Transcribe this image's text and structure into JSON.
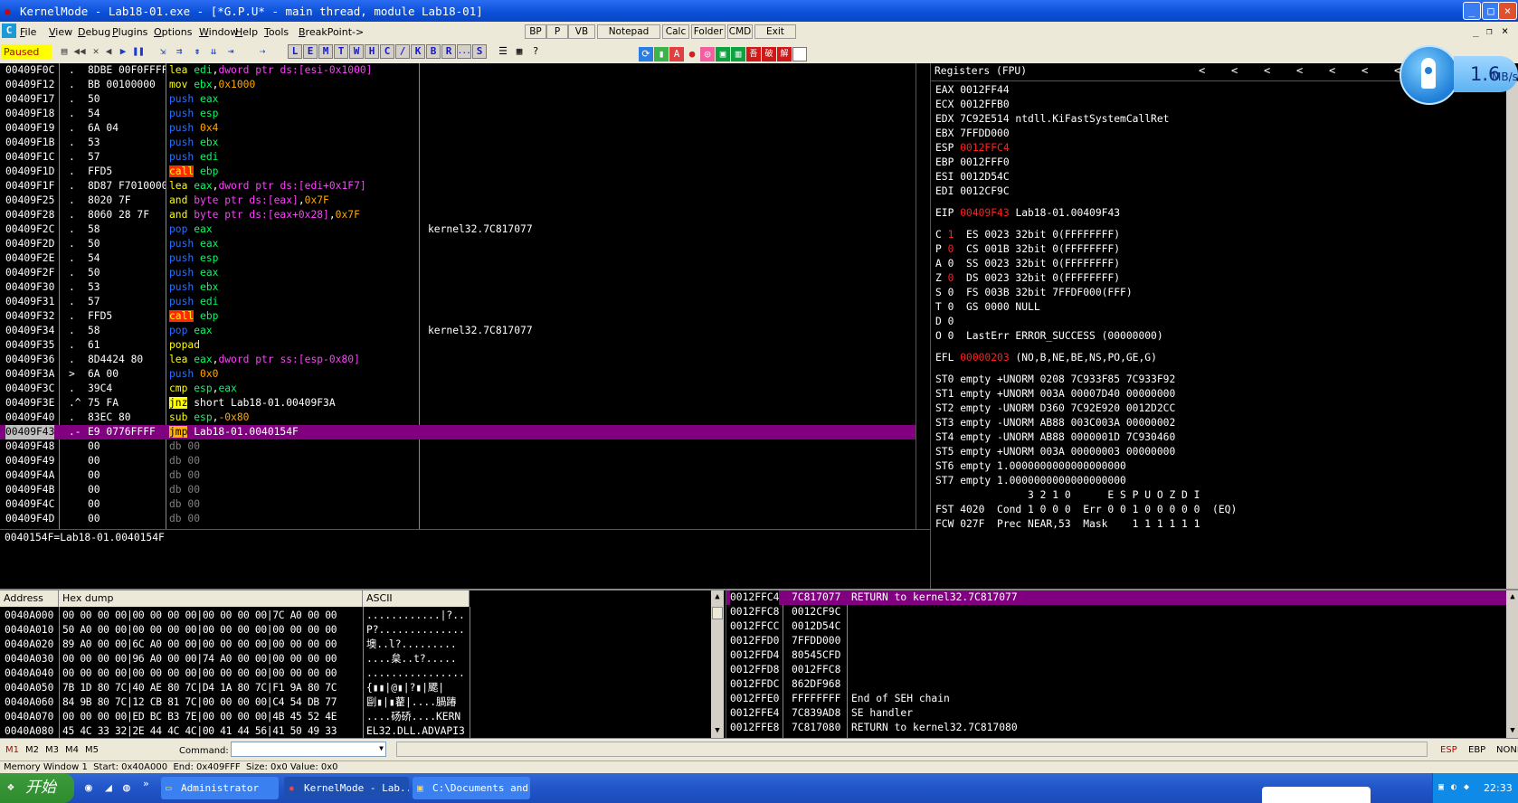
{
  "window": {
    "title": "KernelMode - Lab18-01.exe - [*G.P.U* - main thread, module Lab18-01]",
    "minimize": "_",
    "maximize": "□",
    "close": "×",
    "inner_min": "_",
    "inner_restore": "❐",
    "inner_close": "×"
  },
  "menu": {
    "mdi_icon": "C",
    "items": [
      "File",
      "View",
      "Debug",
      "Plugins",
      "Options",
      "Window",
      "Help",
      "Tools",
      "BreakPoint->"
    ],
    "buttons": [
      "BP",
      "P",
      "VB",
      "Notepad",
      "Calc",
      "Folder",
      "CMD",
      "Exit"
    ]
  },
  "toolbar": {
    "status": "Paused",
    "letters": [
      "L",
      "E",
      "M",
      "T",
      "W",
      "H",
      "C",
      "/",
      "K",
      "B",
      "R",
      "...",
      "S"
    ]
  },
  "disasm": {
    "rows": [
      {
        "addr": "00409F0C",
        "mk": ".",
        "hex": "8DBE 00F0FFFF",
        "mn": "lea",
        "cls": "mn-lea",
        "ops": [
          [
            "edi",
            "reg"
          ],
          [
            ",",
            ""
          ],
          [
            "dword ptr ds:[esi-0x1000]",
            "ptr"
          ]
        ]
      },
      {
        "addr": "00409F12",
        "mk": ".",
        "hex": "BB 00100000",
        "mn": "mov",
        "cls": "mn-mov",
        "ops": [
          [
            "ebx",
            "reg"
          ],
          [
            ",",
            ""
          ],
          [
            "0x1000",
            "imm"
          ]
        ]
      },
      {
        "addr": "00409F17",
        "mk": ".",
        "hex": "50",
        "mn": "push",
        "cls": "mn-push",
        "ops": [
          [
            "eax",
            "reg"
          ]
        ]
      },
      {
        "addr": "00409F18",
        "mk": ".",
        "hex": "54",
        "mn": "push",
        "cls": "mn-push",
        "ops": [
          [
            "esp",
            "reg"
          ]
        ]
      },
      {
        "addr": "00409F19",
        "mk": ".",
        "hex": "6A 04",
        "mn": "push",
        "cls": "mn-push",
        "ops": [
          [
            "0x4",
            "imm"
          ]
        ]
      },
      {
        "addr": "00409F1B",
        "mk": ".",
        "hex": "53",
        "mn": "push",
        "cls": "mn-push",
        "ops": [
          [
            "ebx",
            "reg"
          ]
        ]
      },
      {
        "addr": "00409F1C",
        "mk": ".",
        "hex": "57",
        "mn": "push",
        "cls": "mn-push",
        "ops": [
          [
            "edi",
            "reg"
          ]
        ]
      },
      {
        "addr": "00409F1D",
        "mk": ".",
        "hex": "FFD5",
        "mn": "call",
        "cls": "mn-call",
        "ops": [
          [
            "ebp",
            "reg"
          ]
        ]
      },
      {
        "addr": "00409F1F",
        "mk": ".",
        "hex": "8D87 F7010000",
        "mn": "lea",
        "cls": "mn-lea",
        "ops": [
          [
            "eax",
            "reg"
          ],
          [
            ",",
            ""
          ],
          [
            "dword ptr ds:[edi+0x1F7]",
            "ptr"
          ]
        ]
      },
      {
        "addr": "00409F25",
        "mk": ".",
        "hex": "8020 7F",
        "mn": "and",
        "cls": "mn-and",
        "ops": [
          [
            "byte ptr ds:[eax]",
            "ptr"
          ],
          [
            ",",
            ""
          ],
          [
            "0x7F",
            "imm"
          ]
        ]
      },
      {
        "addr": "00409F28",
        "mk": ".",
        "hex": "8060 28 7F",
        "mn": "and",
        "cls": "mn-and",
        "ops": [
          [
            "byte ptr ds:[eax+0x28]",
            "ptr"
          ],
          [
            ",",
            ""
          ],
          [
            "0x7F",
            "imm"
          ]
        ]
      },
      {
        "addr": "00409F2C",
        "mk": ".",
        "hex": "58",
        "mn": "pop",
        "cls": "mn-pop",
        "ops": [
          [
            "eax",
            "reg"
          ]
        ],
        "cmt": "kernel32.7C817077"
      },
      {
        "addr": "00409F2D",
        "mk": ".",
        "hex": "50",
        "mn": "push",
        "cls": "mn-push",
        "ops": [
          [
            "eax",
            "reg"
          ]
        ]
      },
      {
        "addr": "00409F2E",
        "mk": ".",
        "hex": "54",
        "mn": "push",
        "cls": "mn-push",
        "ops": [
          [
            "esp",
            "reg"
          ]
        ]
      },
      {
        "addr": "00409F2F",
        "mk": ".",
        "hex": "50",
        "mn": "push",
        "cls": "mn-push",
        "ops": [
          [
            "eax",
            "reg"
          ]
        ]
      },
      {
        "addr": "00409F30",
        "mk": ".",
        "hex": "53",
        "mn": "push",
        "cls": "mn-push",
        "ops": [
          [
            "ebx",
            "reg"
          ]
        ]
      },
      {
        "addr": "00409F31",
        "mk": ".",
        "hex": "57",
        "mn": "push",
        "cls": "mn-push",
        "ops": [
          [
            "edi",
            "reg"
          ]
        ]
      },
      {
        "addr": "00409F32",
        "mk": ".",
        "hex": "FFD5",
        "mn": "call",
        "cls": "mn-call",
        "ops": [
          [
            "ebp",
            "reg"
          ]
        ]
      },
      {
        "addr": "00409F34",
        "mk": ".",
        "hex": "58",
        "mn": "pop",
        "cls": "mn-pop",
        "ops": [
          [
            "eax",
            "reg"
          ]
        ],
        "cmt": "kernel32.7C817077"
      },
      {
        "addr": "00409F35",
        "mk": ".",
        "hex": "61",
        "mn": "popad",
        "cls": "mn-popad",
        "ops": []
      },
      {
        "addr": "00409F36",
        "mk": ".",
        "hex": "8D4424 80",
        "mn": "lea",
        "cls": "mn-lea",
        "ops": [
          [
            "eax",
            "reg"
          ],
          [
            ",",
            ""
          ],
          [
            "dword ptr ss:[esp-0x80]",
            "ptr"
          ]
        ]
      },
      {
        "addr": "00409F3A",
        "mk": ">",
        "hex": "6A 00",
        "mn": "push",
        "cls": "mn-push",
        "ops": [
          [
            "0x0",
            "imm"
          ]
        ]
      },
      {
        "addr": "00409F3C",
        "mk": ".",
        "hex": "39C4",
        "mn": "cmp",
        "cls": "mn-cmp",
        "ops": [
          [
            "esp",
            "reg"
          ],
          [
            ",",
            ""
          ],
          [
            "eax",
            "reg"
          ]
        ]
      },
      {
        "addr": "00409F3E",
        "mk": ".^",
        "hex": "75 FA",
        "mn": "jnz",
        "cls": "mn-jnz",
        "ops": [
          [
            "short Lab18-01.00409F3A",
            "w"
          ]
        ]
      },
      {
        "addr": "00409F40",
        "mk": ".",
        "hex": "83EC 80",
        "mn": "sub",
        "cls": "mn-sub",
        "ops": [
          [
            "esp",
            "reg"
          ],
          [
            ",",
            ""
          ],
          [
            "-0x80",
            "imm"
          ]
        ]
      },
      {
        "addr": "00409F43",
        "mk": ".-",
        "hex": "E9 0776FFFF",
        "mn": "jmp",
        "cls": "mn-jmp",
        "ops": [
          [
            "Lab18-01.0040154F",
            "w"
          ]
        ],
        "sel": true
      },
      {
        "addr": "00409F48",
        "mk": "",
        "hex": "00",
        "mn": "db",
        "cls": "mn-db",
        "ops": [
          [
            "00",
            "db"
          ]
        ]
      },
      {
        "addr": "00409F49",
        "mk": "",
        "hex": "00",
        "mn": "db",
        "cls": "mn-db",
        "ops": [
          [
            "00",
            "db"
          ]
        ]
      },
      {
        "addr": "00409F4A",
        "mk": "",
        "hex": "00",
        "mn": "db",
        "cls": "mn-db",
        "ops": [
          [
            "00",
            "db"
          ]
        ]
      },
      {
        "addr": "00409F4B",
        "mk": "",
        "hex": "00",
        "mn": "db",
        "cls": "mn-db",
        "ops": [
          [
            "00",
            "db"
          ]
        ]
      },
      {
        "addr": "00409F4C",
        "mk": "",
        "hex": "00",
        "mn": "db",
        "cls": "mn-db",
        "ops": [
          [
            "00",
            "db"
          ]
        ]
      },
      {
        "addr": "00409F4D",
        "mk": "",
        "hex": "00",
        "mn": "db",
        "cls": "mn-db",
        "ops": [
          [
            "00",
            "db"
          ]
        ]
      }
    ],
    "info": "0040154F=Lab18-01.0040154F"
  },
  "registers": {
    "header": "Registers (FPU)",
    "arrows": [
      "<",
      "<",
      "<",
      "<",
      "<",
      "<",
      "<"
    ],
    "lines": [
      {
        "t": "EAX 0012FF44"
      },
      {
        "t": "ECX 0012FFB0"
      },
      {
        "t": "EDX 7C92E514 ntdll.KiFastSystemCallRet"
      },
      {
        "t": "EBX 7FFDD000"
      },
      {
        "p": "ESP ",
        "r": "0012FFC4"
      },
      {
        "t": "EBP 0012FFF0"
      },
      {
        "t": "ESI 0012D54C"
      },
      {
        "t": "EDI 0012CF9C"
      },
      {
        "gap": true
      },
      {
        "p": "EIP ",
        "r": "00409F43",
        "s": " Lab18-01.00409F43"
      },
      {
        "gap": true
      },
      {
        "p": "C ",
        "r": "1",
        "s": "  ES 0023 32bit 0(FFFFFFFF)"
      },
      {
        "p": "P ",
        "r": "0",
        "s": "  CS 001B 32bit 0(FFFFFFFF)"
      },
      {
        "t": "A 0  SS 0023 32bit 0(FFFFFFFF)"
      },
      {
        "p": "Z ",
        "r": "0",
        "s": "  DS 0023 32bit 0(FFFFFFFF)"
      },
      {
        "t": "S 0  FS 003B 32bit 7FFDF000(FFF)"
      },
      {
        "t": "T 0  GS 0000 NULL"
      },
      {
        "t": "D 0"
      },
      {
        "t": "O 0  LastErr ERROR_SUCCESS (00000000)"
      },
      {
        "gap": true
      },
      {
        "p": "EFL ",
        "r": "00000203",
        "s": " (NO,B,NE,BE,NS,PO,GE,G)"
      },
      {
        "gap": true
      },
      {
        "t": "ST0 empty +UNORM 0208 7C933F85 7C933F92"
      },
      {
        "t": "ST1 empty +UNORM 003A 00007D40 00000000"
      },
      {
        "t": "ST2 empty -UNORM D360 7C92E920 0012D2CC"
      },
      {
        "t": "ST3 empty -UNORM AB88 003C003A 00000002"
      },
      {
        "t": "ST4 empty -UNORM AB88 0000001D 7C930460"
      },
      {
        "t": "ST5 empty +UNORM 003A 00000003 00000000"
      },
      {
        "t": "ST6 empty 1.0000000000000000000"
      },
      {
        "t": "ST7 empty 1.0000000000000000000"
      },
      {
        "t": "               3 2 1 0      E S P U O Z D I"
      },
      {
        "t": "FST 4020  Cond 1 0 0 0  Err 0 0 1 0 0 0 0 0  (EQ)"
      },
      {
        "t": "FCW 027F  Prec NEAR,53  Mask    1 1 1 1 1 1"
      }
    ],
    "speed": "1.6",
    "speed_unit": "MB/s"
  },
  "dump": {
    "headers": [
      "Address",
      "Hex dump",
      "ASCII"
    ],
    "rows": [
      {
        "a": "0040A000",
        "h": "00 00 00 00|00 00 00 00|00 00 00 00|7C A0 00 00",
        "s": "............|?.."
      },
      {
        "a": "0040A010",
        "h": "50 A0 00 00|00 00 00 00|00 00 00 00|00 00 00 00",
        "s": "P?.............."
      },
      {
        "a": "0040A020",
        "h": "89 A0 00 00|6C A0 00 00|00 00 00 00|00 00 00 00",
        "s": "墺..l?........."
      },
      {
        "a": "0040A030",
        "h": "00 00 00 00|96 A0 00 00|74 A0 00 00|00 00 00 00",
        "s": "....枲..t?....."
      },
      {
        "a": "0040A040",
        "h": "00 00 00 00|00 00 00 00|00 00 00 00|00 00 00 00",
        "s": "................"
      },
      {
        "a": "0040A050",
        "h": "7B 1D 80 7C|40 AE 80 7C|D4 1A 80 7C|F1 9A 80 7C",
        "s": "{▮▮|@▮|?▮|颸|"
      },
      {
        "a": "0040A060",
        "h": "84 9B 80 7C|12 CB 81 7C|00 00 00 00|C4 54 DB 77",
        "s": "剾▮|▮藋|....腡踳"
      },
      {
        "a": "0040A070",
        "h": "00 00 00 00|ED BC B3 7E|00 00 00 00|4B 45 52 4E",
        "s": "....砀硚....KERN"
      },
      {
        "a": "0040A080",
        "h": "45 4C 33 32|2E 44 4C 4C|00 41 44 56|41 50 49 33",
        "s": "EL32.DLL.ADVAPI3"
      }
    ]
  },
  "stack": {
    "rows": [
      {
        "a": "0012FFC4",
        "v": "7C817077",
        "c": "RETURN to kernel32.7C817077",
        "sel": true
      },
      {
        "a": "0012FFC8",
        "v": "0012CF9C",
        "c": ""
      },
      {
        "a": "0012FFCC",
        "v": "0012D54C",
        "c": ""
      },
      {
        "a": "0012FFD0",
        "v": "7FFDD000",
        "c": ""
      },
      {
        "a": "0012FFD4",
        "v": "80545CFD",
        "c": ""
      },
      {
        "a": "0012FFD8",
        "v": "0012FFC8",
        "c": ""
      },
      {
        "a": "0012FFDC",
        "v": "862DF968",
        "c": ""
      },
      {
        "a": "0012FFE0",
        "v": "FFFFFFFF",
        "c": "End of SEH chain"
      },
      {
        "a": "0012FFE4",
        "v": "7C839AD8",
        "c": "SE handler"
      },
      {
        "a": "0012FFE8",
        "v": "7C817080",
        "c": "RETURN to kernel32.7C817080"
      }
    ]
  },
  "commandbar": {
    "tabs": [
      "M1",
      "M2",
      "M3",
      "M4",
      "M5"
    ],
    "label": "Command:",
    "value": "",
    "right": [
      "ESP",
      "EBP",
      "NONE"
    ]
  },
  "statusbar": "Memory Window 1  Start: 0x40A000  End: 0x409FFF  Size: 0x0 Value: 0x0",
  "taskbar": {
    "start": "开始",
    "tasks": [
      "Administrator",
      "KernelMode - Lab...",
      "C:\\Documents and..."
    ],
    "clock": "22:33"
  },
  "colors": {
    "selection": "#800080",
    "title": "#0a4fd6",
    "red": "#ff2020"
  }
}
